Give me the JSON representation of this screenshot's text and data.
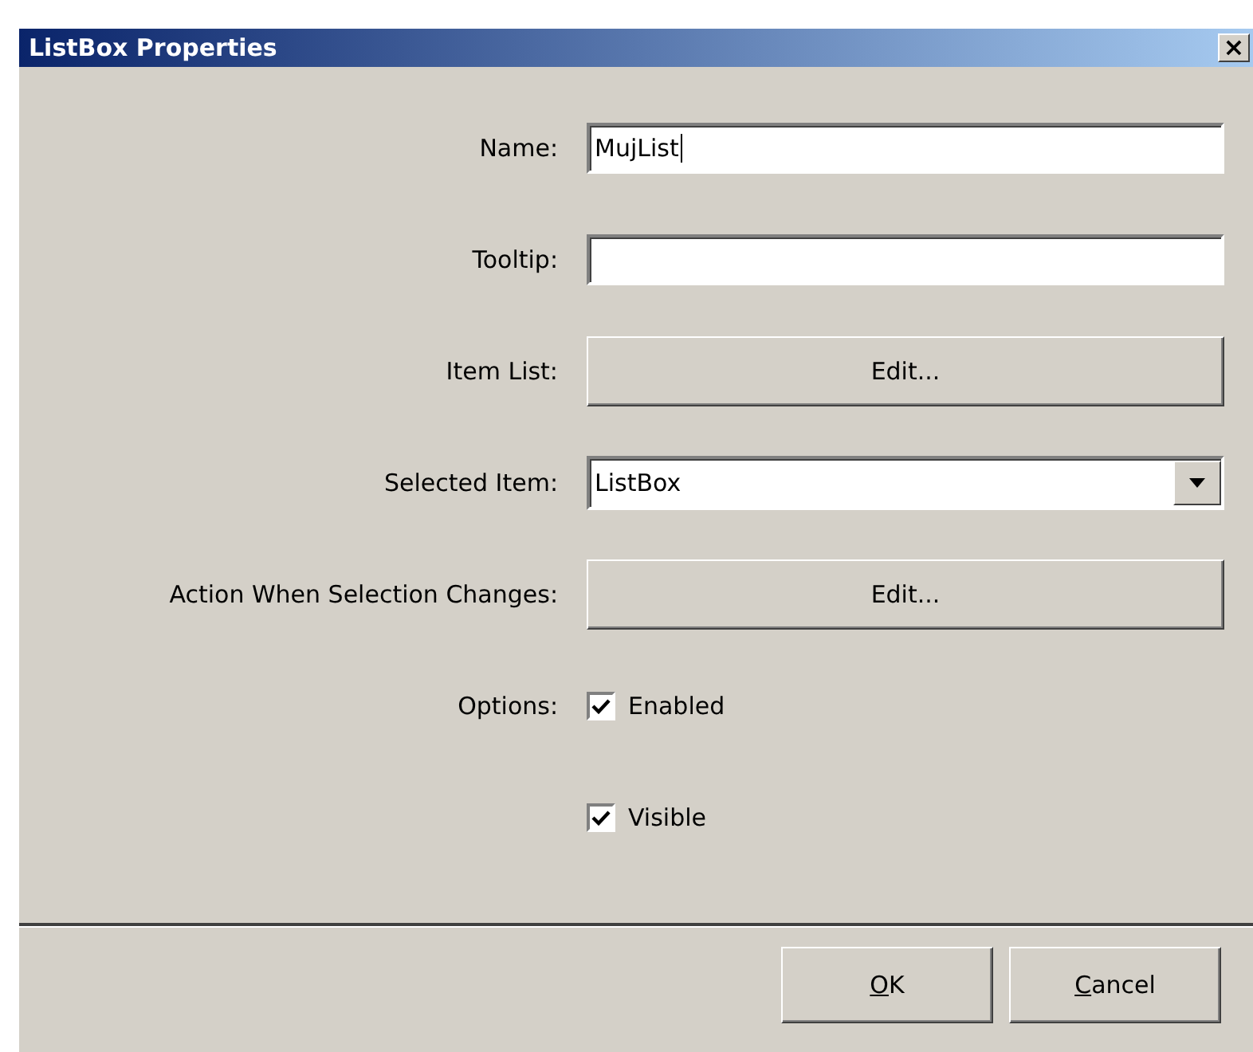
{
  "window": {
    "title": "ListBox Properties",
    "close": "×"
  },
  "fields": [
    {
      "kind": "text",
      "label": "Name:",
      "value": "MujList",
      "focused": true
    },
    {
      "kind": "text",
      "label": "Tooltip:",
      "focused": false
    },
    {
      "kind": "button",
      "label": "Item List:",
      "button": "Edit..."
    },
    {
      "kind": "select",
      "label": "Selected Item:",
      "value": "ListBox"
    },
    {
      "kind": "button",
      "label": "Action When Selection Changes:",
      "button": "Edit..."
    }
  ],
  "options": {
    "label": "Options:",
    "items": [
      {
        "label": "Enabled",
        "checked": true
      },
      {
        "label": "Visible",
        "checked": true
      }
    ]
  },
  "buttons": [
    {
      "label": "OK",
      "mnemonic_underlined": true
    },
    {
      "label": "Cancel",
      "mnemonic_underlined": true
    }
  ]
}
